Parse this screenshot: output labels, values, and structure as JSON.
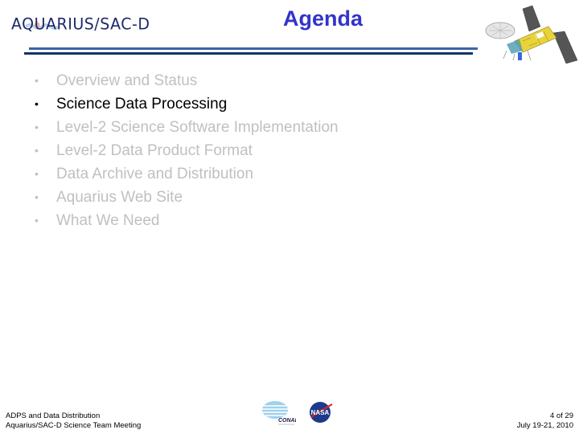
{
  "header": {
    "logo_text": "AQUARIUS/SAC-D",
    "title": "Agenda",
    "colors": {
      "title": "#3333cc",
      "rule_light": "#3b63aa",
      "rule_dark": "#12326e"
    }
  },
  "agenda": {
    "items": [
      {
        "label": "Overview and Status",
        "active": false
      },
      {
        "label": "Science Data Processing",
        "active": true
      },
      {
        "label": "Level-2 Science Software Implementation",
        "active": false
      },
      {
        "label": "Level-2 Data Product Format",
        "active": false
      },
      {
        "label": "Data Archive and Distribution",
        "active": false
      },
      {
        "label": "Aquarius Web Site",
        "active": false
      },
      {
        "label": "What We Need",
        "active": false
      }
    ],
    "bullet": "•"
  },
  "footer": {
    "left_line1": "ADPS and Data Distribution",
    "left_line2": "Aquarius/SAC-D Science Team Meeting",
    "page": "4 of 29",
    "date": "July 19-21, 2010",
    "logos": {
      "conae": "CONAE",
      "nasa": "NASA"
    }
  },
  "icons": {
    "satellite": "satellite-image",
    "conae": "conae-logo",
    "nasa": "nasa-logo"
  }
}
